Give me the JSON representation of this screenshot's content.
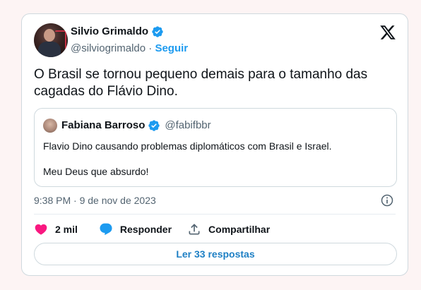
{
  "colors": {
    "accent": "#1d9bf0",
    "verified": "#1d9bf0",
    "like": "#f91880",
    "reply": "#1d9bf0",
    "muted": "#536471",
    "border": "#cfd9de"
  },
  "tweet": {
    "author": {
      "name": "Silvio Grimaldo",
      "handle": "@silviogrimaldo",
      "separator": "·",
      "follow_label": "Seguir",
      "verified_icon": "verified-badge-icon"
    },
    "brand_icon": "x-logo-icon",
    "text": "O Brasil se tornou pequeno demais para o tamanho das cagadas do Flávio Dino.",
    "quote": {
      "name": "Fabiana Barroso",
      "handle": "@fabifbbr",
      "line1": "Flavio Dino causando problemas diplomáticos com Brasil e Israel.",
      "line2": "Meu Deus que absurdo!"
    },
    "timestamp": "9:38 PM · 9 de nov de 2023",
    "info_icon": "info-icon",
    "actions": {
      "likes_count": "2 mil",
      "reply_label": "Responder",
      "share_label": "Compartilhar"
    },
    "read_replies_label": "Ler 33 respostas"
  }
}
